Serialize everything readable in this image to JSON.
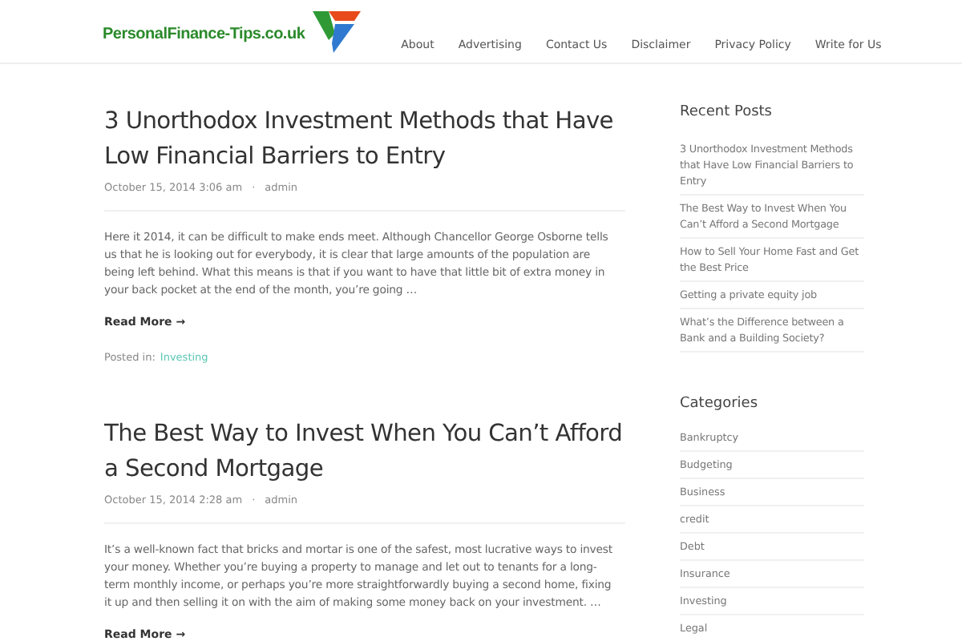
{
  "header": {
    "logo_text": "PersonalFinance-Tips.co.uk",
    "nav": [
      "About",
      "Advertising",
      "Contact Us",
      "Disclaimer",
      "Privacy Policy",
      "Write for Us"
    ]
  },
  "posts": [
    {
      "title": "3 Unorthodox Investment Methods that Have Low Financial Barriers to Entry",
      "date": "October 15, 2014 3:06 am",
      "separator": "·",
      "author": "admin",
      "excerpt": "Here it 2014, it can be difficult to make ends meet. Although Chancellor George Osborne tells us that he is looking out for everybody, it is clear that large amounts of the population are being left behind. What this means is that if you want to have that little bit of extra money in your back pocket at the end of the month, you’re going …",
      "read_more": "Read More →",
      "posted_in_label": "Posted in:",
      "category": "Investing"
    },
    {
      "title": "The Best Way to Invest When You Can’t Afford a Second Mortgage",
      "date": "October 15, 2014 2:28 am",
      "separator": "·",
      "author": "admin",
      "excerpt": "It’s a well-known fact that bricks and mortar is one of the safest, most lucrative ways to invest your money. Whether you’re buying a property to manage and let out to tenants for a long-term monthly income, or perhaps you’re more straightforwardly buying a second home, fixing it up and then selling it on with the aim of making some money back on your investment. …",
      "read_more": "Read More →"
    }
  ],
  "sidebar": {
    "recent_posts": {
      "title": "Recent Posts",
      "items": [
        "3 Unorthodox Investment Methods that Have Low Financial Barriers to Entry",
        "The Best Way to Invest When You Can’t Afford a Second Mortgage",
        "How to Sell Your Home Fast and Get the Best Price",
        "Getting a private equity job",
        "What’s the Difference between a Bank and a Building Society?"
      ]
    },
    "categories": {
      "title": "Categories",
      "items": [
        "Bankruptcy",
        "Budgeting",
        "Business",
        "credit",
        "Debt",
        "Insurance",
        "Investing",
        "Legal"
      ]
    }
  }
}
